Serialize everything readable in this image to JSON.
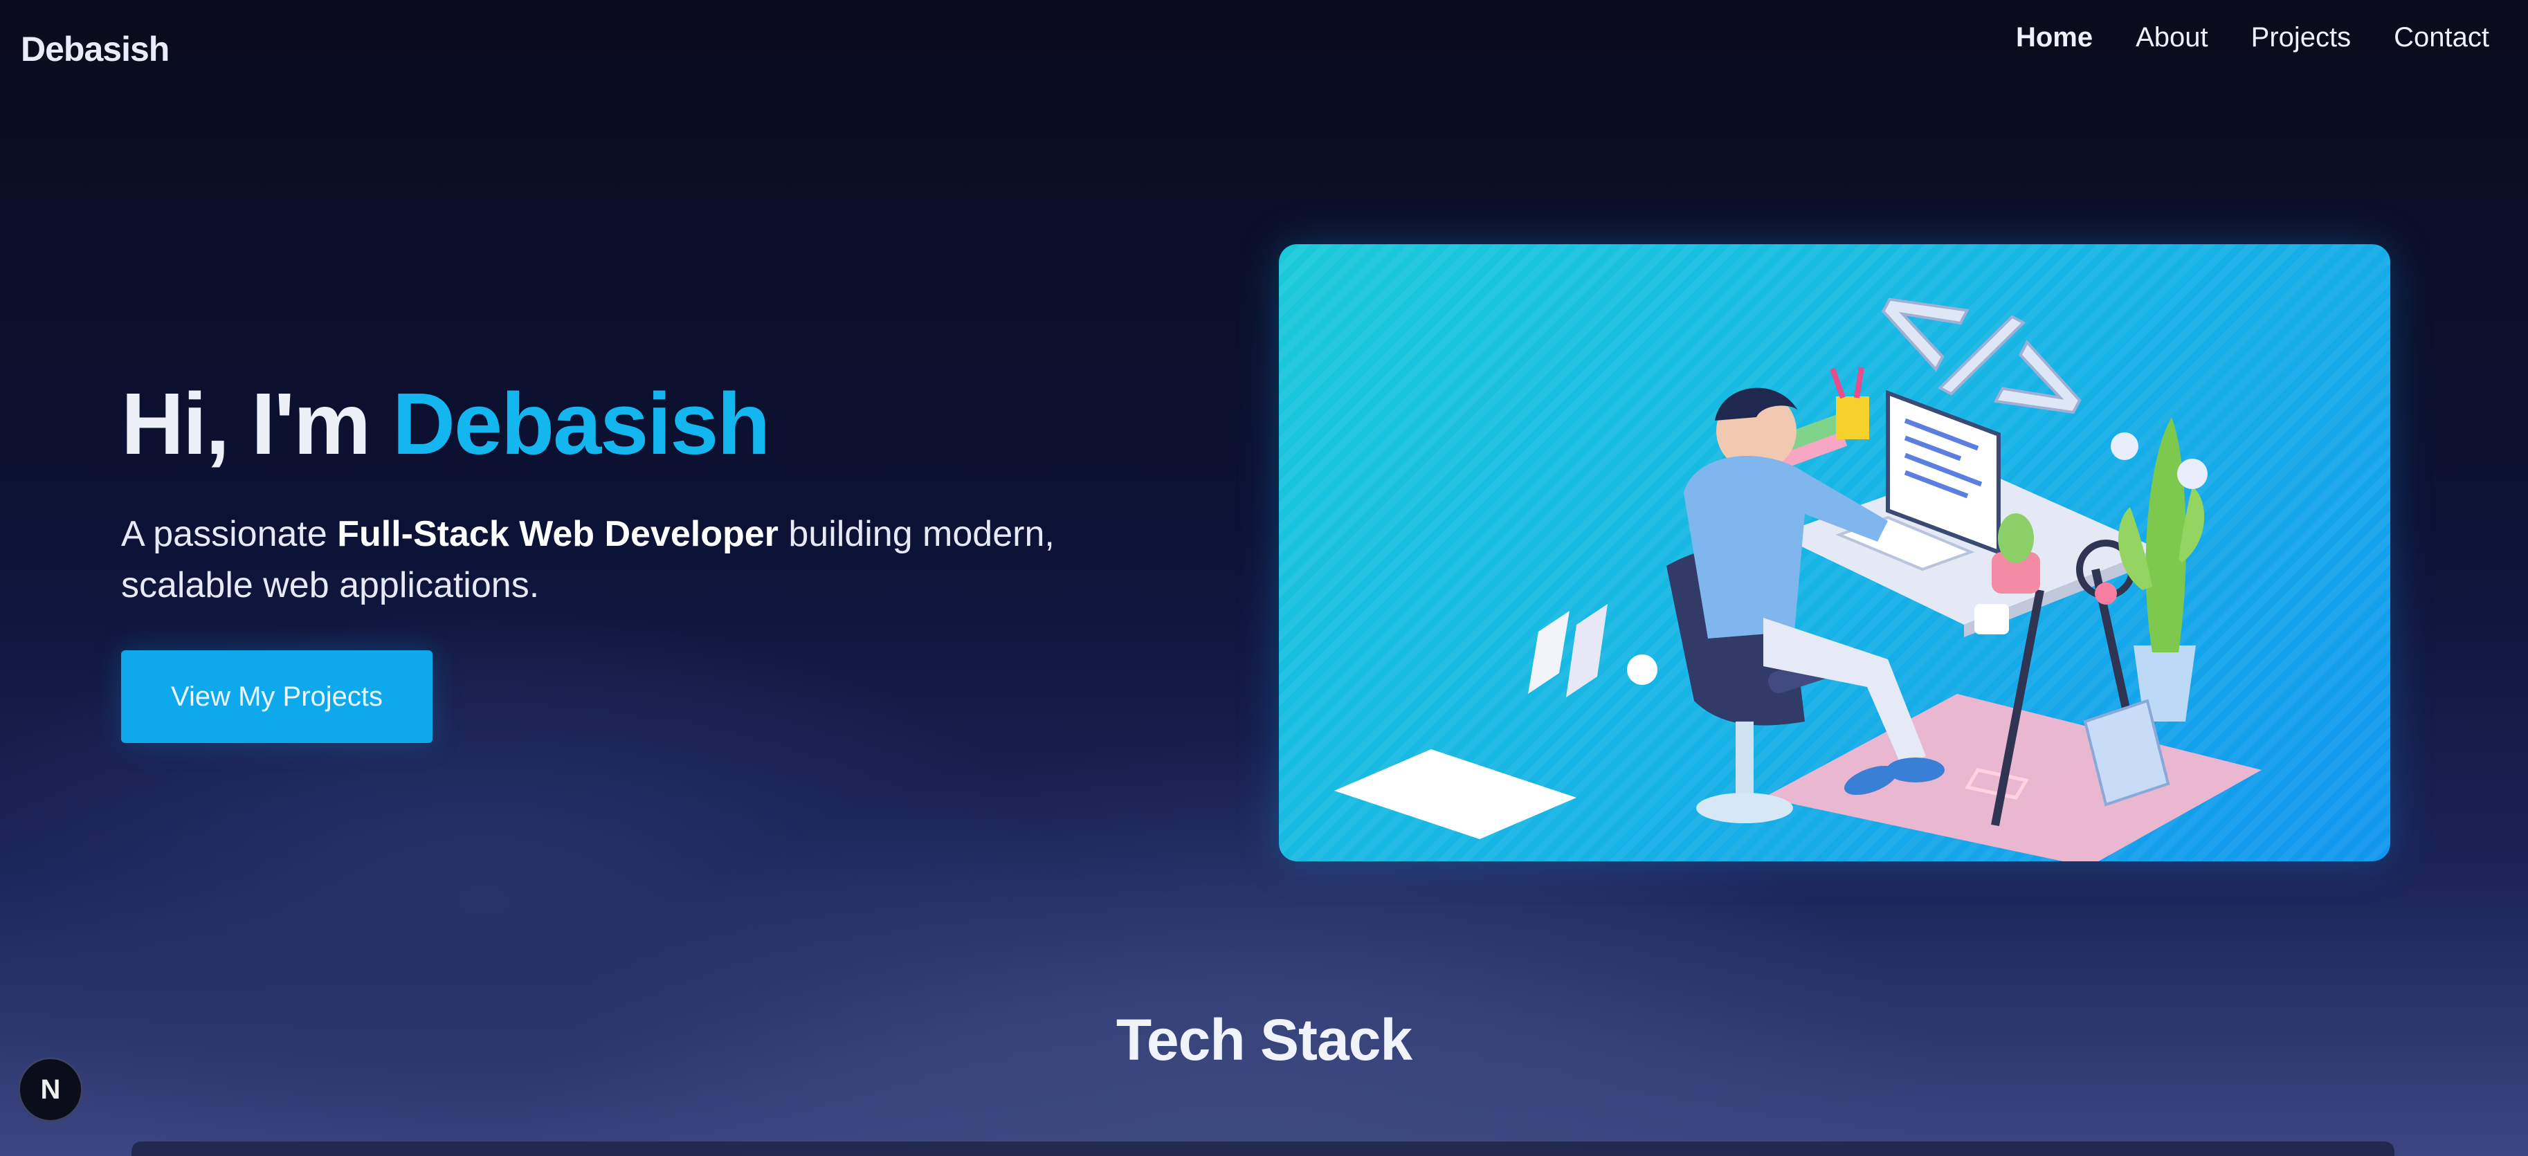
{
  "nav": {
    "brand": "Debasish",
    "links": [
      {
        "label": "Home"
      },
      {
        "label": "About"
      },
      {
        "label": "Projects"
      },
      {
        "label": "Contact"
      }
    ]
  },
  "hero": {
    "greeting": "Hi, I'm ",
    "name": "Debasish",
    "subtitle_pre": "A passionate ",
    "subtitle_strong": "Full-Stack Web Developer",
    "subtitle_post": " building modern, scalable web applications.",
    "cta_label": "View My Projects",
    "illustration_icon": "developer-at-desk-illustration",
    "code_symbol": "</>"
  },
  "tech_stack": {
    "title": "Tech Stack"
  },
  "badge": {
    "letter": "N"
  },
  "colors": {
    "accent": "#14b6f0",
    "button": "#0ea8ec",
    "background": "#0b0f2a"
  }
}
